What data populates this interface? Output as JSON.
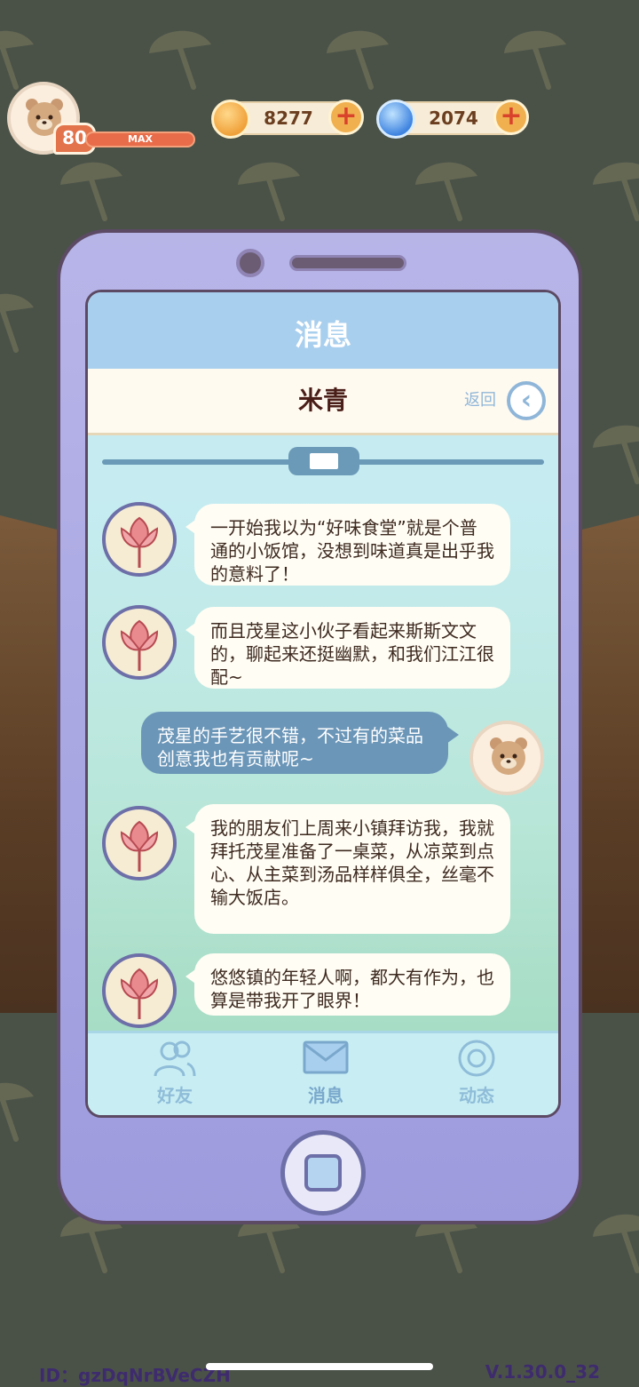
{
  "hud": {
    "level": "80",
    "level_label": "MAX",
    "coins": "8277",
    "gems": "2074",
    "plus": "+"
  },
  "screen": {
    "title": "消息",
    "contact_name": "米青",
    "back_label": "返回"
  },
  "messages": [
    {
      "side": "left",
      "text": "一开始我以为“好味食堂”就是个普通的小饭馆，没想到味道真是出乎我的意料了！"
    },
    {
      "side": "left",
      "text": "而且茂星这小伙子看起来斯斯文文的，聊起来还挺幽默，和我们江江很配~"
    },
    {
      "side": "right",
      "text": "茂星的手艺很不错，不过有的菜品创意我也有贡献呢~"
    },
    {
      "side": "left",
      "text": "我的朋友们上周来小镇拜访我，我就拜托茂星准备了一桌菜，从凉菜到点心、从主菜到汤品样样俱全，丝毫不输大饭店。"
    },
    {
      "side": "left",
      "text": "悠悠镇的年轻人啊，都大有作为，也算是带我开了眼界！"
    }
  ],
  "tabs": [
    {
      "label": "好友",
      "icon": "friends-icon"
    },
    {
      "label": "消息",
      "icon": "mail-icon"
    },
    {
      "label": "动态",
      "icon": "moments-icon"
    }
  ],
  "footer": {
    "id": "ID：gzDqNrBVeCZH",
    "version": "V.1.30.0_32"
  },
  "colors": {
    "phone_body": "#9d9bdd",
    "screen_header": "#a9cfee",
    "bubble_left": "#fffdf4",
    "bubble_right": "#6b96b8"
  }
}
